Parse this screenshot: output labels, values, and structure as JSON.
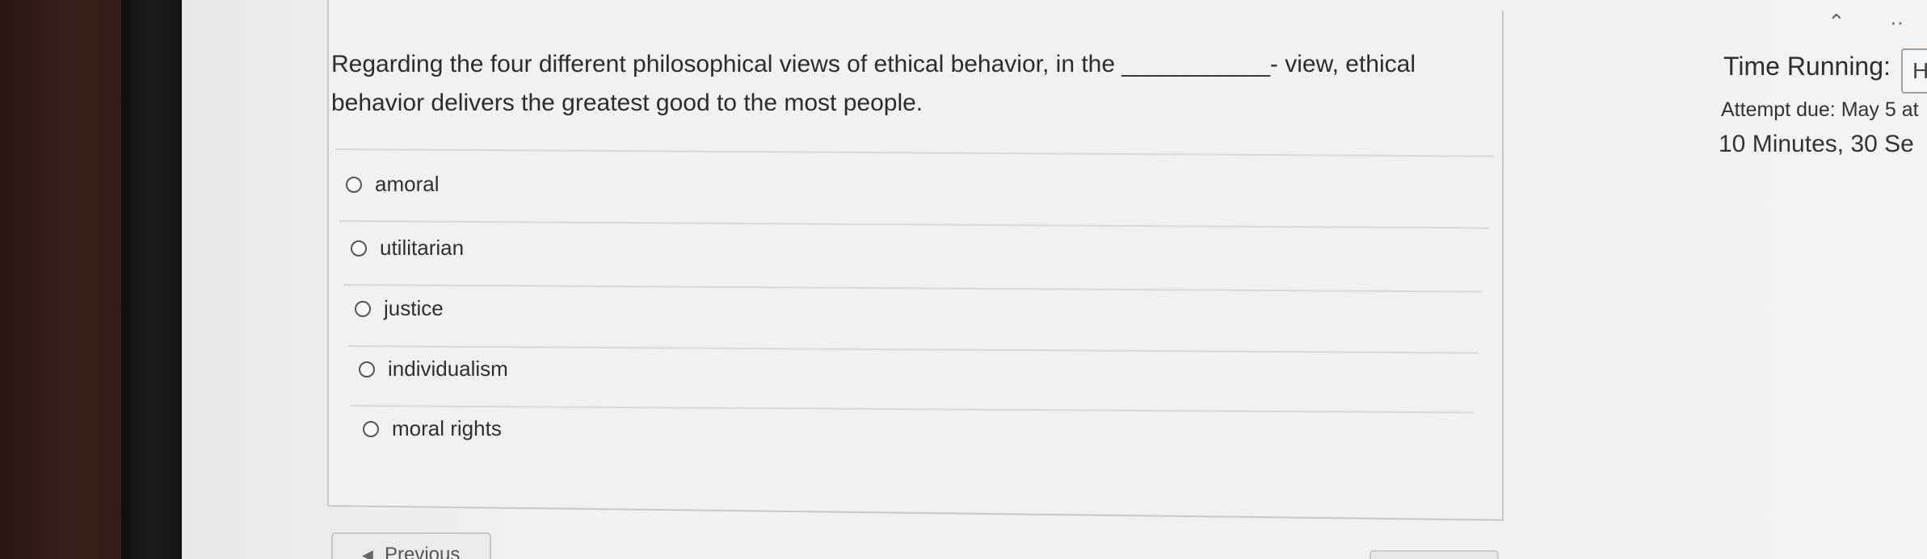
{
  "question": {
    "text": "Regarding the four different philosophical views of ethical behavior, in the ___________- view, ethical behavior delivers the greatest good to the most people.",
    "options": [
      {
        "label": "amoral"
      },
      {
        "label": "utilitarian"
      },
      {
        "label": "justice"
      },
      {
        "label": "individualism"
      },
      {
        "label": "moral rights"
      }
    ]
  },
  "sidebar": {
    "time_running_label": "Time Running:",
    "hide_button_text": "H",
    "attempt_due": "Attempt due: May 5 at",
    "time_remaining": "10 Minutes, 30 Se"
  },
  "navigation": {
    "previous_label": "Previous"
  }
}
